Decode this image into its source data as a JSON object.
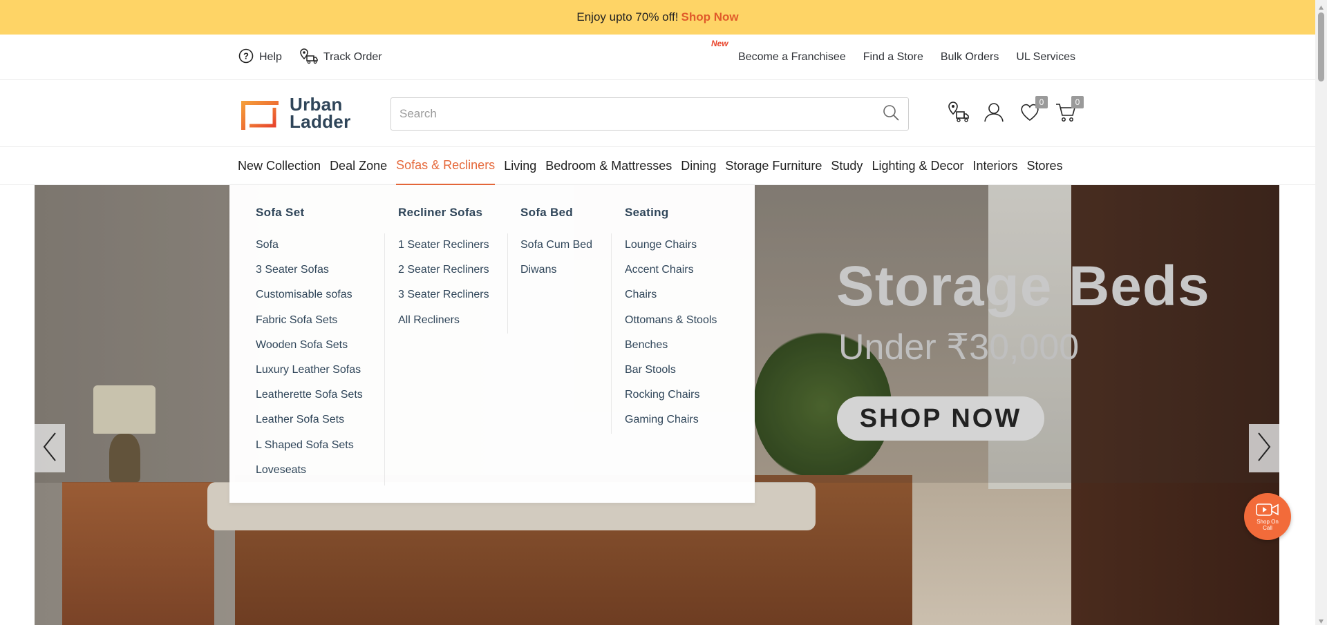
{
  "promo": {
    "text": "Enjoy upto 70% off!",
    "link": "Shop Now"
  },
  "util": {
    "help": "Help",
    "track_order": "Track Order",
    "new_badge": "New",
    "links": [
      "Become a Franchisee",
      "Find a Store",
      "Bulk Orders",
      "UL Services"
    ]
  },
  "logo": {
    "line1": "Urban",
    "line2": "Ladder"
  },
  "search": {
    "placeholder": "Search"
  },
  "header_counts": {
    "wishlist": "0",
    "cart": "0"
  },
  "nav": [
    "New Collection",
    "Deal Zone",
    "Sofas & Recliners",
    "Living",
    "Bedroom & Mattresses",
    "Dining",
    "Storage Furniture",
    "Study",
    "Lighting & Decor",
    "Interiors",
    "Stores"
  ],
  "mega_menu": {
    "sofa_set": {
      "title": "Sofa Set",
      "items": [
        "Sofa",
        "3 Seater Sofas",
        "Customisable sofas",
        "Fabric Sofa Sets",
        "Wooden Sofa Sets",
        "Luxury Leather Sofas",
        "Leatherette Sofa Sets",
        "Leather Sofa Sets",
        "L Shaped Sofa Sets",
        "Loveseats"
      ]
    },
    "recliner_sofas": {
      "title": "Recliner Sofas",
      "items": [
        "1 Seater Recliners",
        "2 Seater Recliners",
        "3 Seater Recliners",
        "All Recliners"
      ]
    },
    "sofa_bed": {
      "title": "Sofa Bed",
      "items": [
        "Sofa Cum Bed",
        "Diwans"
      ]
    },
    "seating": {
      "title": "Seating",
      "items": [
        "Lounge Chairs",
        "Accent Chairs",
        "Chairs",
        "Ottomans & Stools",
        "Benches",
        "Bar Stools",
        "Rocking Chairs",
        "Gaming Chairs"
      ]
    }
  },
  "hero": {
    "title": "Storage Beds",
    "subtitle": "Under ₹30,000",
    "cta": "SHOP NOW"
  },
  "call_button": {
    "label_1": "Shop On",
    "label_2": "Call"
  },
  "colors": {
    "accent": "#e5683a",
    "promo_bg": "#fed466",
    "call_button": "#f26b3a"
  }
}
